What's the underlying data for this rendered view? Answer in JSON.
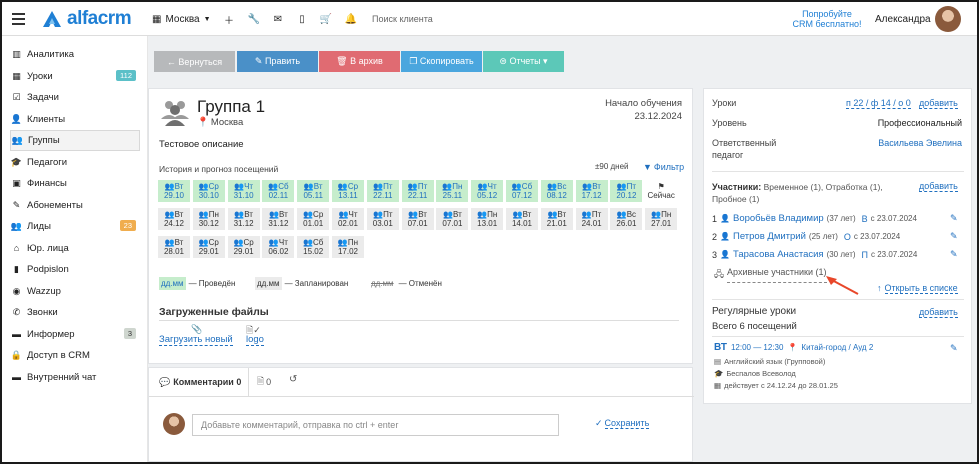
{
  "header": {
    "logo_text": "alfacrm",
    "branch": "Москва",
    "search_placeholder": "Поиск клиента",
    "try_crm_line1": "Попробуйте",
    "try_crm_line2": "CRM бесплатно!",
    "user_name": "Александра",
    "icons": [
      "menu-icon",
      "building-icon",
      "plus-icon",
      "wrench-icon",
      "mail-icon",
      "mobile-icon",
      "cart-icon",
      "bell-icon"
    ],
    "accent_color": "#1f7fd4"
  },
  "sidebar": {
    "items": [
      {
        "label": "Аналитика",
        "icon": "analytics-icon",
        "glyph": "▥"
      },
      {
        "label": "Уроки",
        "icon": "lessons-icon",
        "glyph": "▦",
        "badge": "112",
        "badge_color": "#5bc0c8"
      },
      {
        "label": "Задачи",
        "icon": "tasks-icon",
        "glyph": "☑"
      },
      {
        "label": "Клиенты",
        "icon": "clients-icon",
        "glyph": "👤"
      },
      {
        "label": "Группы",
        "icon": "groups-icon",
        "glyph": "👥",
        "active": true
      },
      {
        "label": "Педагоги",
        "icon": "teachers-icon",
        "glyph": "🎓"
      },
      {
        "label": "Финансы",
        "icon": "finance-icon",
        "glyph": "▣"
      },
      {
        "label": "Абонементы",
        "icon": "subscriptions-icon",
        "glyph": "✎"
      },
      {
        "label": "Лиды",
        "icon": "leads-icon",
        "glyph": "👥",
        "badge": "23",
        "badge_color": "#f0ad4e"
      },
      {
        "label": "Юр. лица",
        "icon": "legal-icon",
        "glyph": "⌂"
      },
      {
        "label": "Podpislon",
        "icon": "doc-icon",
        "glyph": "▮"
      },
      {
        "label": "Wazzup",
        "icon": "whatsapp-icon",
        "glyph": "◉"
      },
      {
        "label": "Звонки",
        "icon": "phone-icon",
        "glyph": "✆"
      },
      {
        "label": "Информер",
        "icon": "informer-icon",
        "glyph": "▬",
        "badge": "3",
        "badge_color": "#cfd6cf"
      },
      {
        "label": "Доступ в CRM",
        "icon": "lock-icon",
        "glyph": "🔒"
      },
      {
        "label": "Внутренний чат",
        "icon": "chat-icon",
        "glyph": "▬"
      }
    ]
  },
  "toolbar": {
    "back": "← Вернуться",
    "edit": "✎ Править",
    "archive": "🗑 В архив",
    "copy": "❐ Скопировать",
    "reports": "⊜ Отчеты ▾"
  },
  "group": {
    "title": "Группа 1",
    "location": "Москва",
    "start_label": "Начало обучения",
    "start_date": "23.12.2024",
    "description": "Тестовое описание",
    "history_label": "История и прогноз посещений",
    "days_filter": "±90 дней",
    "filter_label": "Фильтр",
    "today_label": "Сейчас",
    "visits": [
      {
        "d": "Вт",
        "dt": "29.10",
        "s": "p"
      },
      {
        "d": "Ср",
        "dt": "30.10",
        "s": "p"
      },
      {
        "d": "Чт",
        "dt": "31.10",
        "s": "p"
      },
      {
        "d": "Сб",
        "dt": "02.11",
        "s": "p"
      },
      {
        "d": "Вт",
        "dt": "05.11",
        "s": "p"
      },
      {
        "d": "Ср",
        "dt": "13.11",
        "s": "p"
      },
      {
        "d": "Пт",
        "dt": "22.11",
        "s": "p"
      },
      {
        "d": "Пт",
        "dt": "22.11",
        "s": "p"
      },
      {
        "d": "Пн",
        "dt": "25.11",
        "s": "p"
      },
      {
        "d": "Чт",
        "dt": "05.12",
        "s": "p"
      },
      {
        "d": "Сб",
        "dt": "07.12",
        "s": "p"
      },
      {
        "d": "Вс",
        "dt": "08.12",
        "s": "p"
      },
      {
        "d": "Вт",
        "dt": "17.12",
        "s": "p"
      },
      {
        "d": "Пт",
        "dt": "20.12",
        "s": "p"
      },
      {
        "d": "Вт",
        "dt": "24.12",
        "s": "f"
      },
      {
        "d": "Пн",
        "dt": "30.12",
        "s": "f"
      },
      {
        "d": "Вт",
        "dt": "31.12",
        "s": "f"
      },
      {
        "d": "Вт",
        "dt": "31.12",
        "s": "f"
      },
      {
        "d": "Ср",
        "dt": "01.01",
        "s": "f"
      },
      {
        "d": "Чт",
        "dt": "02.01",
        "s": "f"
      },
      {
        "d": "Пт",
        "dt": "03.01",
        "s": "f"
      },
      {
        "d": "Вт",
        "dt": "07.01",
        "s": "f"
      },
      {
        "d": "Вт",
        "dt": "07.01",
        "s": "f"
      },
      {
        "d": "Пн",
        "dt": "13.01",
        "s": "f"
      },
      {
        "d": "Вт",
        "dt": "14.01",
        "s": "f"
      },
      {
        "d": "Вт",
        "dt": "21.01",
        "s": "f"
      },
      {
        "d": "Пт",
        "dt": "24.01",
        "s": "f"
      },
      {
        "d": "Вс",
        "dt": "26.01",
        "s": "f"
      },
      {
        "d": "Пн",
        "dt": "27.01",
        "s": "f"
      },
      {
        "d": "Вт",
        "dt": "28.01",
        "s": "f"
      },
      {
        "d": "Ср",
        "dt": "29.01",
        "s": "f"
      },
      {
        "d": "Ср",
        "dt": "29.01",
        "s": "f"
      },
      {
        "d": "Чт",
        "dt": "06.02",
        "s": "f"
      },
      {
        "d": "Сб",
        "dt": "15.02",
        "s": "f"
      },
      {
        "d": "Пн",
        "dt": "17.02",
        "s": "f"
      }
    ],
    "legend_sample": "дд.мм",
    "legend_done": "— Проведён",
    "legend_planned": "— Запланирован",
    "legend_cancelled": "— Отменён",
    "files_title": "Загруженные файлы",
    "upload_label": "Загрузить новый",
    "file_name": "logo",
    "present_color": "#c6edcc"
  },
  "comments": {
    "tab_comments": "Комментарии 0",
    "tab_files": "0",
    "placeholder": "Добавьте комментарий, отправка по ctrl + enter",
    "save_label": "Сохранить"
  },
  "details": {
    "lessons_label": "Уроки",
    "lessons_value": "п 22 / ф 14 / о 0",
    "add": "добавить",
    "level_label": "Уровень",
    "level_value": "Профессиональный",
    "responsible_label1": "Ответственный",
    "responsible_label2": "педагог",
    "responsible_value": "Васильева Эвелина",
    "participants_title": "Участники:",
    "participants_meta1": "Временное (1), Отработка (1),",
    "participants_meta2": "Пробное (1)",
    "participants": [
      {
        "num": "1",
        "name": "Воробьёв Владимир",
        "age": "(37 лет)",
        "tag": "В",
        "since": "с 23.07.2024"
      },
      {
        "num": "2",
        "name": "Петров Дмитрий",
        "age": "(25 лет)",
        "tag": "О",
        "since": "с 23.07.2024"
      },
      {
        "num": "3",
        "name": "Тарасова Анастасия",
        "age": "(30 лет)",
        "tag": "П",
        "since": "с 23.07.2024"
      }
    ],
    "archived": "Архивные участники (1)",
    "open_list": "Открыть в списке",
    "regular_title": "Регулярные уроки",
    "regular_total": "Всего 6 посещений",
    "regular_add": "добавить",
    "reg_day": "ВТ",
    "reg_time": "12:00 — 12:30",
    "reg_place": "Китай-город / Ауд 2",
    "reg_subject": "Английский язык (Групповой)",
    "reg_teacher": "Беспалов Всеволод",
    "reg_period": "действует с 24.12.24 до 28.01.25"
  }
}
